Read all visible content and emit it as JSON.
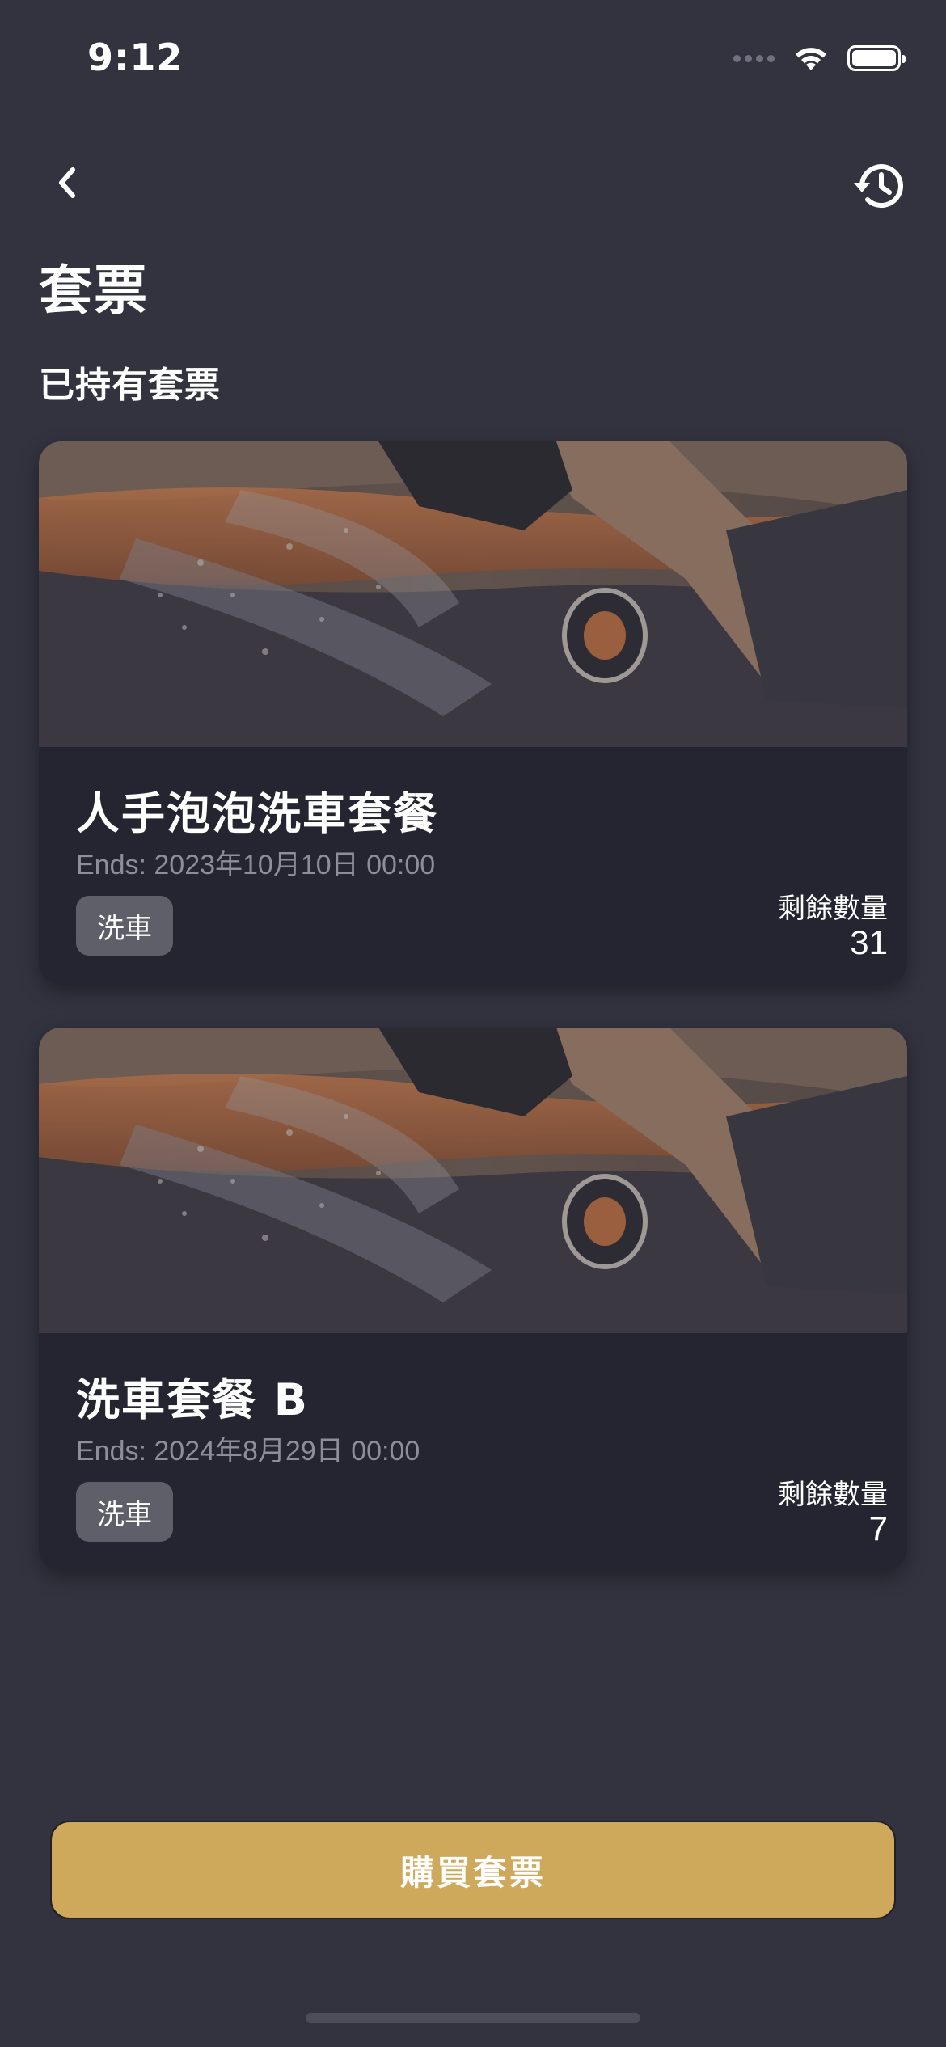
{
  "status_bar": {
    "time": "9:12"
  },
  "nav": {
    "back_icon": "chevron-left-icon",
    "history_icon": "history-icon"
  },
  "page": {
    "title": "套票",
    "section_title": "已持有套票"
  },
  "cards": [
    {
      "title": "人手泡泡洗車套餐",
      "ends": "Ends: 2023年10月10日 00:00",
      "tag": "洗車",
      "remaining_label": "剩餘數量",
      "remaining_value": "31"
    },
    {
      "title": "洗車套餐 B",
      "ends": "Ends: 2024年8月29日 00:00",
      "tag": "洗車",
      "remaining_label": "剩餘數量",
      "remaining_value": "7"
    }
  ],
  "footer": {
    "buy_button_label": "購買套票"
  },
  "colors": {
    "background": "#32333f",
    "card": "#242530",
    "accent": "#cfa95b",
    "tag": "#5e5f69"
  }
}
